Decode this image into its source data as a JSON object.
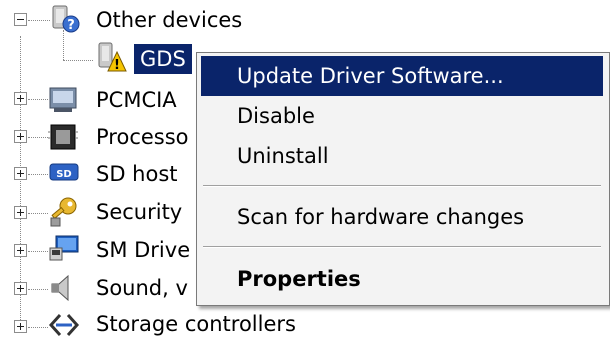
{
  "tree": {
    "items": [
      {
        "label": "Other devices",
        "icon": "unknown-device-icon"
      },
      {
        "label": "GDS",
        "icon": "warning-device-icon"
      },
      {
        "label": "PCMCIA",
        "icon": "pcmcia-icon"
      },
      {
        "label": "Processo",
        "icon": "processor-icon"
      },
      {
        "label": "SD host",
        "icon": "sd-host-icon"
      },
      {
        "label": "Security",
        "icon": "security-key-icon"
      },
      {
        "label": "SM Drive",
        "icon": "sm-driver-icon"
      },
      {
        "label": "Sound, v",
        "icon": "speaker-icon"
      },
      {
        "label": "Storage controllers",
        "icon": "storage-controller-icon"
      }
    ]
  },
  "context_menu": {
    "items": [
      {
        "label": "Update Driver Software..."
      },
      {
        "label": "Disable"
      },
      {
        "label": "Uninstall"
      },
      {
        "label": "Scan for hardware changes"
      },
      {
        "label": "Properties"
      }
    ]
  },
  "colors": {
    "selection": "#0a246a",
    "menu_background": "#f3f3f3",
    "warning": "#f5c400"
  }
}
